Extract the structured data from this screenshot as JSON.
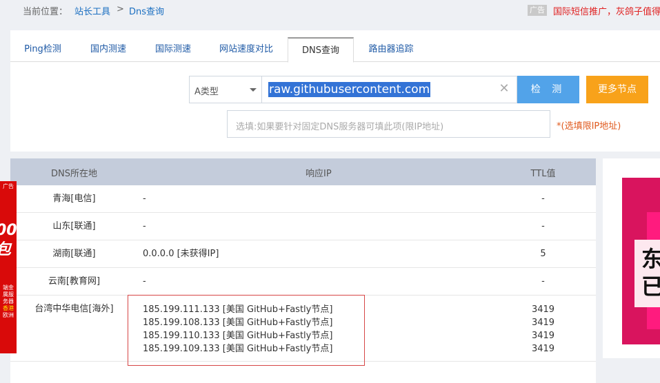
{
  "breadcrumb": {
    "prefix": "当前位置：",
    "item1": "站长工具",
    "separator": ">",
    "item2": "Dns查询"
  },
  "top_ad": {
    "tag": "广告",
    "text": "国际短信推广，灰鸽子值得"
  },
  "tabs": [
    {
      "label": "Ping检测"
    },
    {
      "label": "国内测速"
    },
    {
      "label": "国际测速"
    },
    {
      "label": "网站速度对比"
    },
    {
      "label": "DNS查询"
    },
    {
      "label": "路由器追踪"
    }
  ],
  "active_tab": "DNS查询",
  "search": {
    "type_value": "A类型",
    "domain_value": "raw.githubusercontent.com",
    "check_button": "检 测",
    "more_button": "更多节点",
    "dns_placeholder": "选填:如果要针对固定DNS服务器可填此项(限IP地址)",
    "dns_note": "*(选填限IP地址)"
  },
  "table": {
    "headers": {
      "location": "DNS所在地",
      "ip": "响应IP",
      "ttl": "TTL值"
    },
    "rows": [
      {
        "location": "青海[电信]",
        "ips": [
          "-"
        ],
        "ttls": [
          "-"
        ]
      },
      {
        "location": "山东[联通]",
        "ips": [
          "-"
        ],
        "ttls": [
          "-"
        ]
      },
      {
        "location": "湖南[联通]",
        "ips": [
          "0.0.0.0 [未获得IP]"
        ],
        "ttls": [
          "5"
        ]
      },
      {
        "location": "云南[教育网]",
        "ips": [
          "-"
        ],
        "ttls": [
          "-"
        ]
      },
      {
        "location": "台湾中华电信[海外]",
        "ips": [
          "185.199.111.133 [美国 GitHub+Fastly节点]",
          "185.199.108.133 [美国 GitHub+Fastly节点]",
          "185.199.110.133 [美国 GitHub+Fastly节点]",
          "185.199.109.133 [美国 GitHub+Fastly节点]"
        ],
        "ttls": [
          "3419",
          "3419",
          "3419",
          "3419"
        ]
      }
    ]
  },
  "left_ad": {
    "tag": "广告",
    "big": "00\n包",
    "small": "端金属服务器",
    "small_yellow": "香港",
    "small_tail": "欧洲"
  },
  "right_ad": {
    "text": "东\n已"
  },
  "colors": {
    "accent": "#52a3e9",
    "more": "#f8a21a",
    "link": "#1f5aa6",
    "highlight": "#d64545"
  }
}
